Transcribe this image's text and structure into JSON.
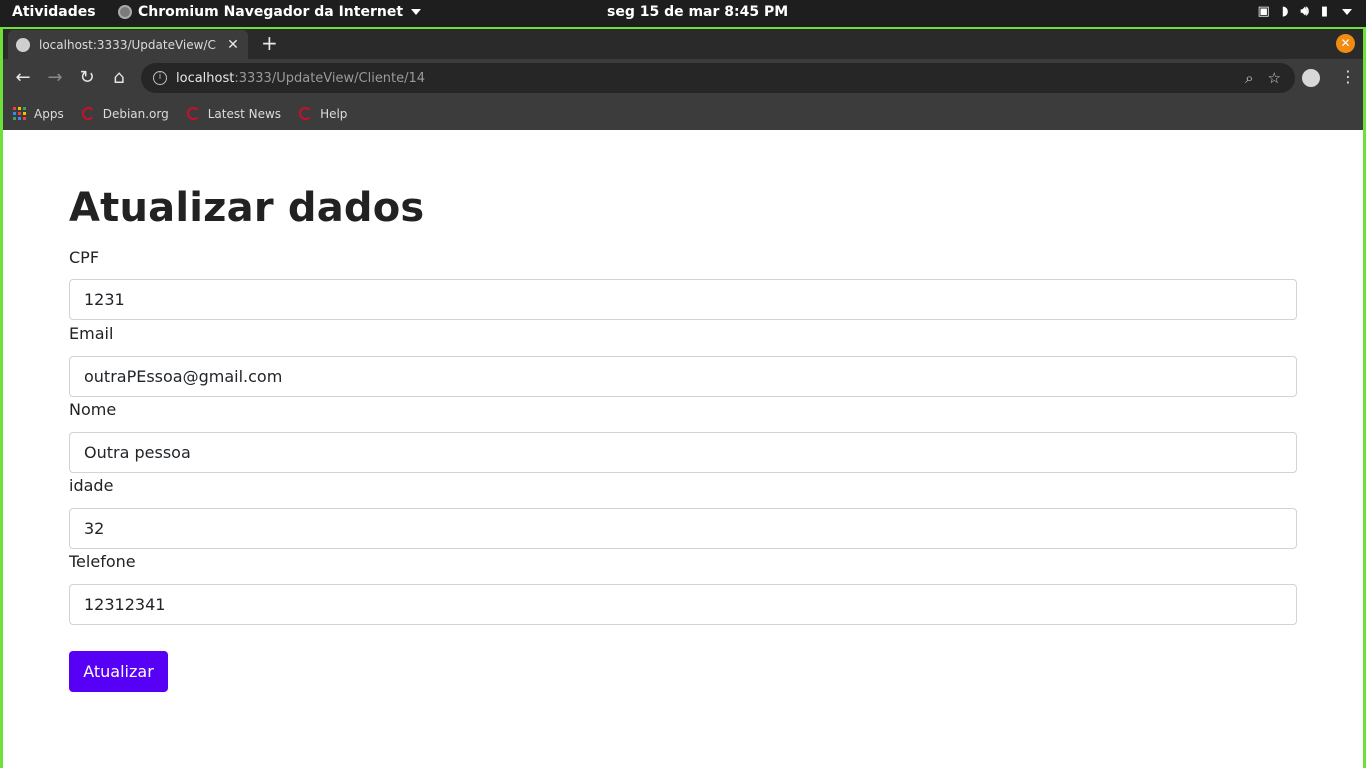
{
  "system_bar": {
    "activities": "Atividades",
    "app_name": "Chromium Navegador da Internet",
    "clock": "seg 15 de mar   8:45 PM"
  },
  "browser": {
    "tab_title": "localhost:3333/UpdateView/C",
    "url_host": "localhost",
    "url_path": ":3333/UpdateView/Cliente/14",
    "bookmarks": [
      {
        "label": "Apps",
        "icon": "apps-grid-icon"
      },
      {
        "label": "Debian.org",
        "icon": "debian-icon"
      },
      {
        "label": "Latest News",
        "icon": "debian-icon"
      },
      {
        "label": "Help",
        "icon": "debian-icon"
      }
    ],
    "frame_color": "#6de03a"
  },
  "form": {
    "title": "Atualizar dados",
    "fields": [
      {
        "label": "CPF",
        "value": "1231"
      },
      {
        "label": "Email",
        "value": "outraPEssoa@gmail.com"
      },
      {
        "label": "Nome",
        "value": "Outra pessoa"
      },
      {
        "label": "idade",
        "value": "32"
      },
      {
        "label": "Telefone",
        "value": "12312341"
      }
    ],
    "submit_label": "Atualizar",
    "accent_color": "#5600f5"
  }
}
